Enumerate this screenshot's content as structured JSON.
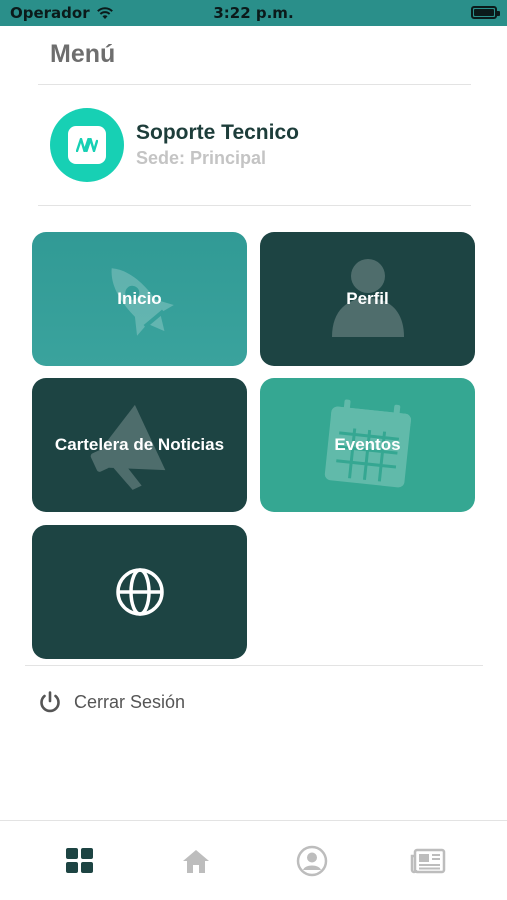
{
  "status_bar": {
    "carrier": "Operador",
    "time": "3:22 p.m."
  },
  "menu": {
    "title": "Menú"
  },
  "profile": {
    "name": "Soporte Tecnico",
    "sede": "Sede: Principal",
    "logo_icon": "company-logo-icon"
  },
  "tiles": [
    {
      "label": "Inicio",
      "icon": "rocket-icon"
    },
    {
      "label": "Perfil",
      "icon": "user-icon"
    },
    {
      "label": "Cartelera de Noticias",
      "icon": "megaphone-icon"
    },
    {
      "label": "Eventos",
      "icon": "calendar-icon"
    },
    {
      "label": "",
      "icon": "globe-icon"
    }
  ],
  "logout": {
    "label": "Cerrar Sesión",
    "icon": "power-icon"
  },
  "tabbar": [
    {
      "name": "menu",
      "icon": "grid-icon",
      "active": true
    },
    {
      "name": "home",
      "icon": "home-icon",
      "active": false
    },
    {
      "name": "profile",
      "icon": "user-circle-icon",
      "active": false
    },
    {
      "name": "news",
      "icon": "newspaper-icon",
      "active": false
    }
  ],
  "colors": {
    "primary_dark": "#1d4443",
    "teal": "#319a95",
    "green": "#35a792",
    "accent": "#17d0b4",
    "status_bar": "#2a8f8a"
  }
}
